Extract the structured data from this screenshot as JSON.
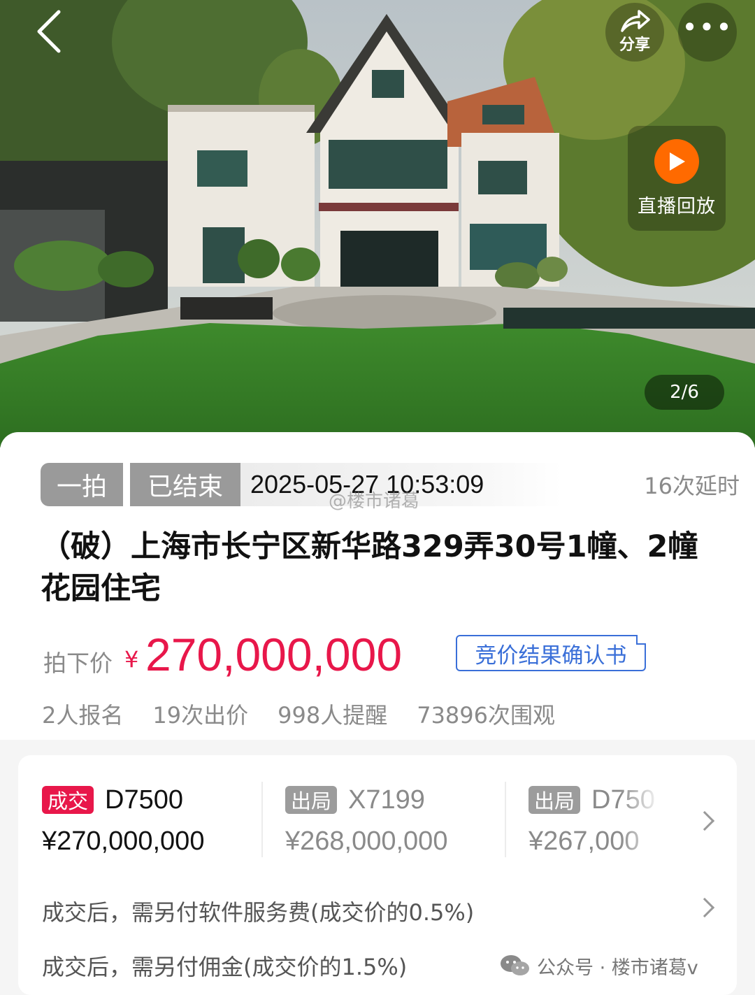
{
  "hero": {
    "share_label": "分享",
    "more_label": "•••",
    "replay_label": "直播回放",
    "image_counter": "2/6"
  },
  "status": {
    "round_tag": "一拍",
    "state_tag": "已结束",
    "end_time": "2025-05-27 10:53:09",
    "extensions": "16次延时"
  },
  "title": "（破）上海市长宁区新华路329弄30号1幢、2幢花园住宅",
  "price": {
    "label": "拍下价",
    "currency": "¥",
    "value": "270,000,000",
    "confirm_button": "竞价结果确认书"
  },
  "stats": [
    "2人报名",
    "19次出价",
    "998人提醒",
    "73896次围观"
  ],
  "bids": [
    {
      "status": "成交",
      "bidder": "D7500",
      "amount": "¥270,000,000"
    },
    {
      "status": "出局",
      "bidder": "X7199",
      "amount": "¥268,000,000"
    },
    {
      "status": "出局",
      "bidder": "D750",
      "amount": "¥267,000"
    }
  ],
  "fees": [
    "成交后，需另付软件服务费(成交价的0.5%)",
    "成交后，需另付佣金(成交价的1.5%)"
  ],
  "watermarks": {
    "center": "@楼市诸葛",
    "bottom": "公众号 · 楼市诸葛v"
  },
  "colors": {
    "accent_red": "#e8174a",
    "link_blue": "#3a6fd8",
    "replay_orange": "#ff6a00",
    "tag_gray": "#9a9a9a"
  },
  "icons": [
    "back-arrow-icon",
    "share-icon",
    "more-icon",
    "play-icon",
    "chevron-right-icon",
    "wechat-icon",
    "weibo-icon"
  ]
}
